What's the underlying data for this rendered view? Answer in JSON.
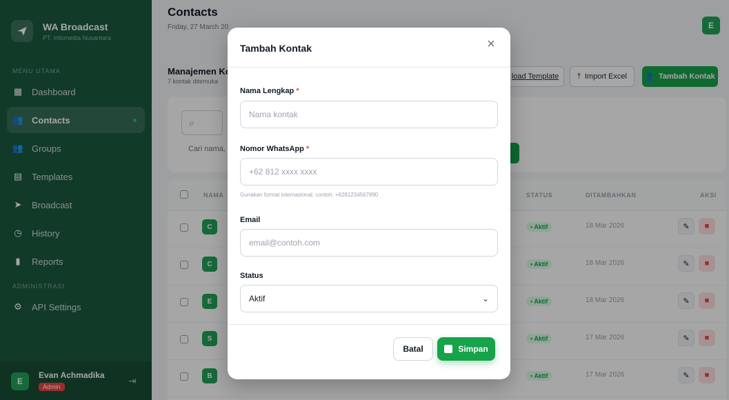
{
  "brand": {
    "title": "WA Broadcast",
    "subtitle": "PT. Infomedia Nusantara"
  },
  "sidebar": {
    "section_main": "MENU UTAMA",
    "section_admin": "ADMINISTRASI",
    "items": [
      {
        "label": "Dashboard",
        "icon": "dashboard-icon"
      },
      {
        "label": "Contacts",
        "icon": "contacts-icon",
        "active": true
      },
      {
        "label": "Groups",
        "icon": "groups-icon"
      },
      {
        "label": "Templates",
        "icon": "templates-icon"
      },
      {
        "label": "Broadcast",
        "icon": "broadcast-icon"
      },
      {
        "label": "History",
        "icon": "history-icon"
      },
      {
        "label": "Reports",
        "icon": "reports-icon"
      }
    ],
    "admin_items": [
      {
        "label": "API Settings",
        "icon": "settings-icon"
      }
    ],
    "user": {
      "name": "Evan Achmadika",
      "role": "Admin",
      "initial": "E"
    }
  },
  "header": {
    "title": "Contacts",
    "date": "Friday, 27 March 20",
    "avatar": "E"
  },
  "main": {
    "section_title": "Manajemen Ko",
    "section_sub": "7 kontak ditemuka",
    "buttons": {
      "download": "load Template",
      "import": "Import Excel",
      "add": "Tambah Kontak"
    },
    "search_placeholder": "Cari nama,"
  },
  "table": {
    "headers": {
      "name": "NAMA",
      "status": "STATUS",
      "added": "DITAMBAHKAN",
      "action": "AKSI"
    },
    "rows": [
      {
        "initial": "C",
        "status": "• Aktif",
        "date": "18 Mar 2026"
      },
      {
        "initial": "C",
        "status": "• Aktif",
        "date": "18 Mar 2026"
      },
      {
        "initial": "E",
        "status": "• Aktif",
        "date": "18 Mar 2026"
      },
      {
        "initial": "S",
        "status": "• Aktif",
        "date": "17 Mar 2026"
      },
      {
        "initial": "B",
        "status": "• Aktif",
        "date": "17 Mar 2026"
      }
    ]
  },
  "modal": {
    "title": "Tambah Kontak",
    "name_label": "Nama Lengkap",
    "name_placeholder": "Nama kontak",
    "phone_label": "Nomor WhatsApp",
    "phone_placeholder": "+62 812 xxxx xxxx",
    "phone_help": "Gunakan format internasional, contoh: +6281234567890",
    "email_label": "Email",
    "email_placeholder": "email@contoh.com",
    "status_label": "Status",
    "status_value": "Aktif",
    "cancel_label": "Batal",
    "save_label": "Simpan"
  }
}
